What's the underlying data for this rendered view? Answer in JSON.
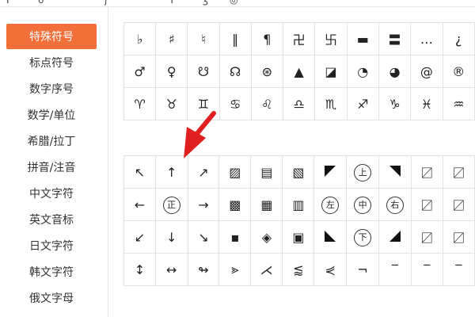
{
  "top_strip": [
    "Ͱ",
    "ʊ",
    "ʃ",
    "Ͳ",
    "ʒ",
    "◎"
  ],
  "sidebar": {
    "items": [
      {
        "label": "特殊符号",
        "active": true
      },
      {
        "label": "标点符号"
      },
      {
        "label": "数字序号"
      },
      {
        "label": "数学/单位"
      },
      {
        "label": "希腊/拉丁"
      },
      {
        "label": "拼音/注音"
      },
      {
        "label": "中文字符"
      },
      {
        "label": "英文音标"
      },
      {
        "label": "日文字符"
      },
      {
        "label": "韩文字符"
      },
      {
        "label": "俄文字母"
      }
    ]
  },
  "symbols_top": [
    [
      "♭",
      "♯",
      "♮",
      "‖",
      "¶",
      "卍",
      "卐",
      "▬",
      "〓",
      "…",
      "¿"
    ],
    [
      "♂",
      "♀",
      "☋",
      "☊",
      "⊛",
      "▲",
      "◪",
      "◔",
      "◕",
      "@",
      "®"
    ],
    [
      "♈",
      "♉",
      "♊",
      "♋",
      "♌",
      "♎",
      "♏",
      "♐",
      "♑",
      "♓",
      "♒"
    ]
  ],
  "symbols_bottom": [
    [
      "↖",
      "↑",
      "↗",
      "▨",
      "▤",
      "▧",
      "◤",
      "上",
      "◥",
      "〼",
      "〼"
    ],
    [
      "←",
      "正",
      "→",
      "▩",
      "▦",
      "▥",
      "左",
      "中",
      "右",
      "〼",
      "〼"
    ],
    [
      "↙",
      "↓",
      "↘",
      "▪",
      "◈",
      "▣",
      "◣",
      "下",
      "◢",
      "〼",
      "〼"
    ],
    [
      "↕",
      "↔",
      "↬",
      "⪢",
      "⋌",
      "⪅",
      "⋞",
      "¬",
      "‾",
      "‾",
      "‾"
    ]
  ],
  "colors": {
    "accent": "#f26f3a",
    "annotation_arrow": "#e02020",
    "grid_border": "#e3e3e3"
  }
}
